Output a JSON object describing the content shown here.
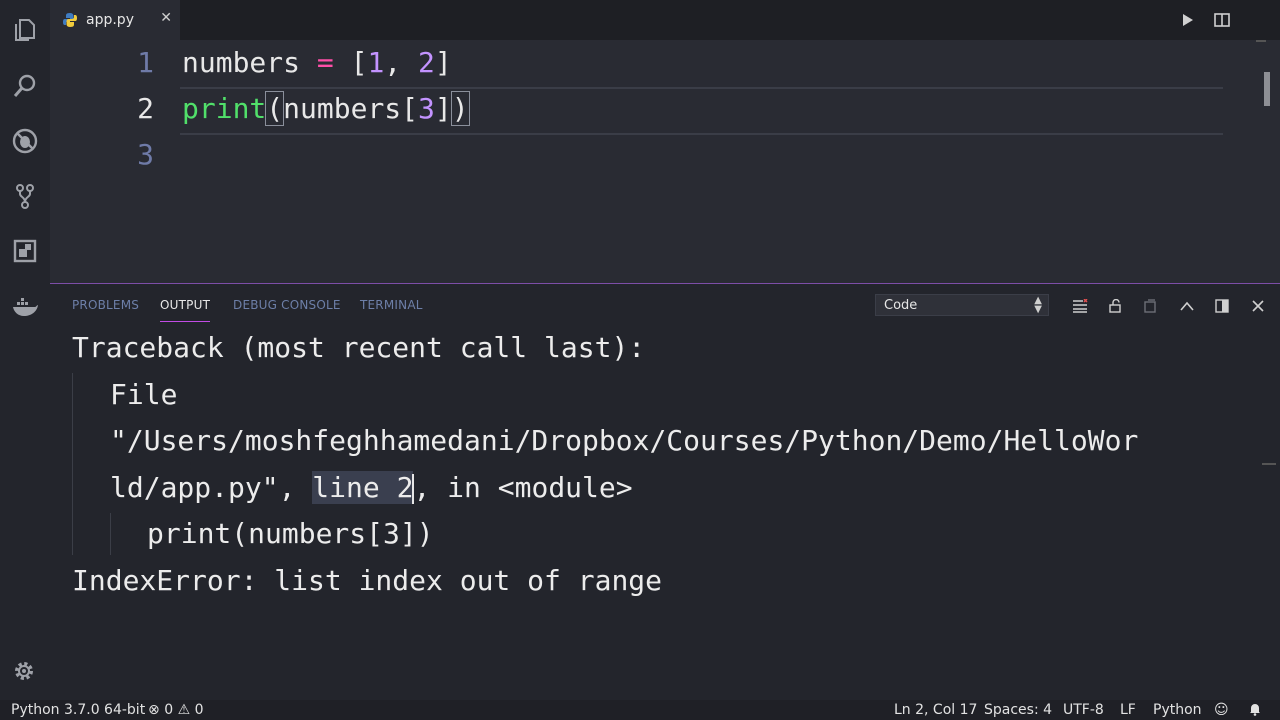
{
  "editor": {
    "tab_label": "app.py",
    "line_numbers": [
      "1",
      "2",
      "3"
    ],
    "lines": [
      {
        "t1": "numbers ",
        "op": "=",
        "t2": " [",
        "n1": "1",
        "t3": ", ",
        "n2": "2",
        "t4": "]"
      },
      {
        "fn": "print",
        "open": "(",
        "t1": "numbers[",
        "n1": "3",
        "t2": "]",
        "close": ")"
      }
    ]
  },
  "panel": {
    "tabs": [
      "PROBLEMS",
      "OUTPUT",
      "DEBUG CONSOLE",
      "TERMINAL"
    ],
    "active_tab": "OUTPUT",
    "channel": "Code",
    "output": {
      "line1": "Traceback (most recent call last):",
      "line2": "File",
      "line3": "\"/Users/moshfeghhamedani/Dropbox/Courses/Python/Demo/HelloWor",
      "line4_a": "ld/app.py\", ",
      "line4_sel": "line 2",
      "line4_b": ", in <module>",
      "line5": "print(numbers[3])",
      "line6": "IndexError: list index out of range"
    }
  },
  "status": {
    "interpreter": "Python 3.7.0 64-bit",
    "errors": "0",
    "warnings": "0",
    "position": "Ln 2, Col 17",
    "spaces": "Spaces: 4",
    "encoding": "UTF-8",
    "eol": "LF",
    "language": "Python"
  },
  "colors": {
    "accent": "#c24ce6",
    "keyword_fn": "#51e06a",
    "number": "#c393ff",
    "operator": "#ff4fa8"
  },
  "icons": [
    "explorer-icon",
    "search-icon",
    "debug-icon",
    "source-control-icon",
    "extensions-icon",
    "docker-icon",
    "settings-icon",
    "run-icon",
    "split-editor-icon",
    "clear-output-icon",
    "lock-scroll-icon",
    "open-log-icon",
    "maximize-panel-icon",
    "close-panel-icon",
    "smiley-icon",
    "bell-icon",
    "python-file-icon"
  ]
}
